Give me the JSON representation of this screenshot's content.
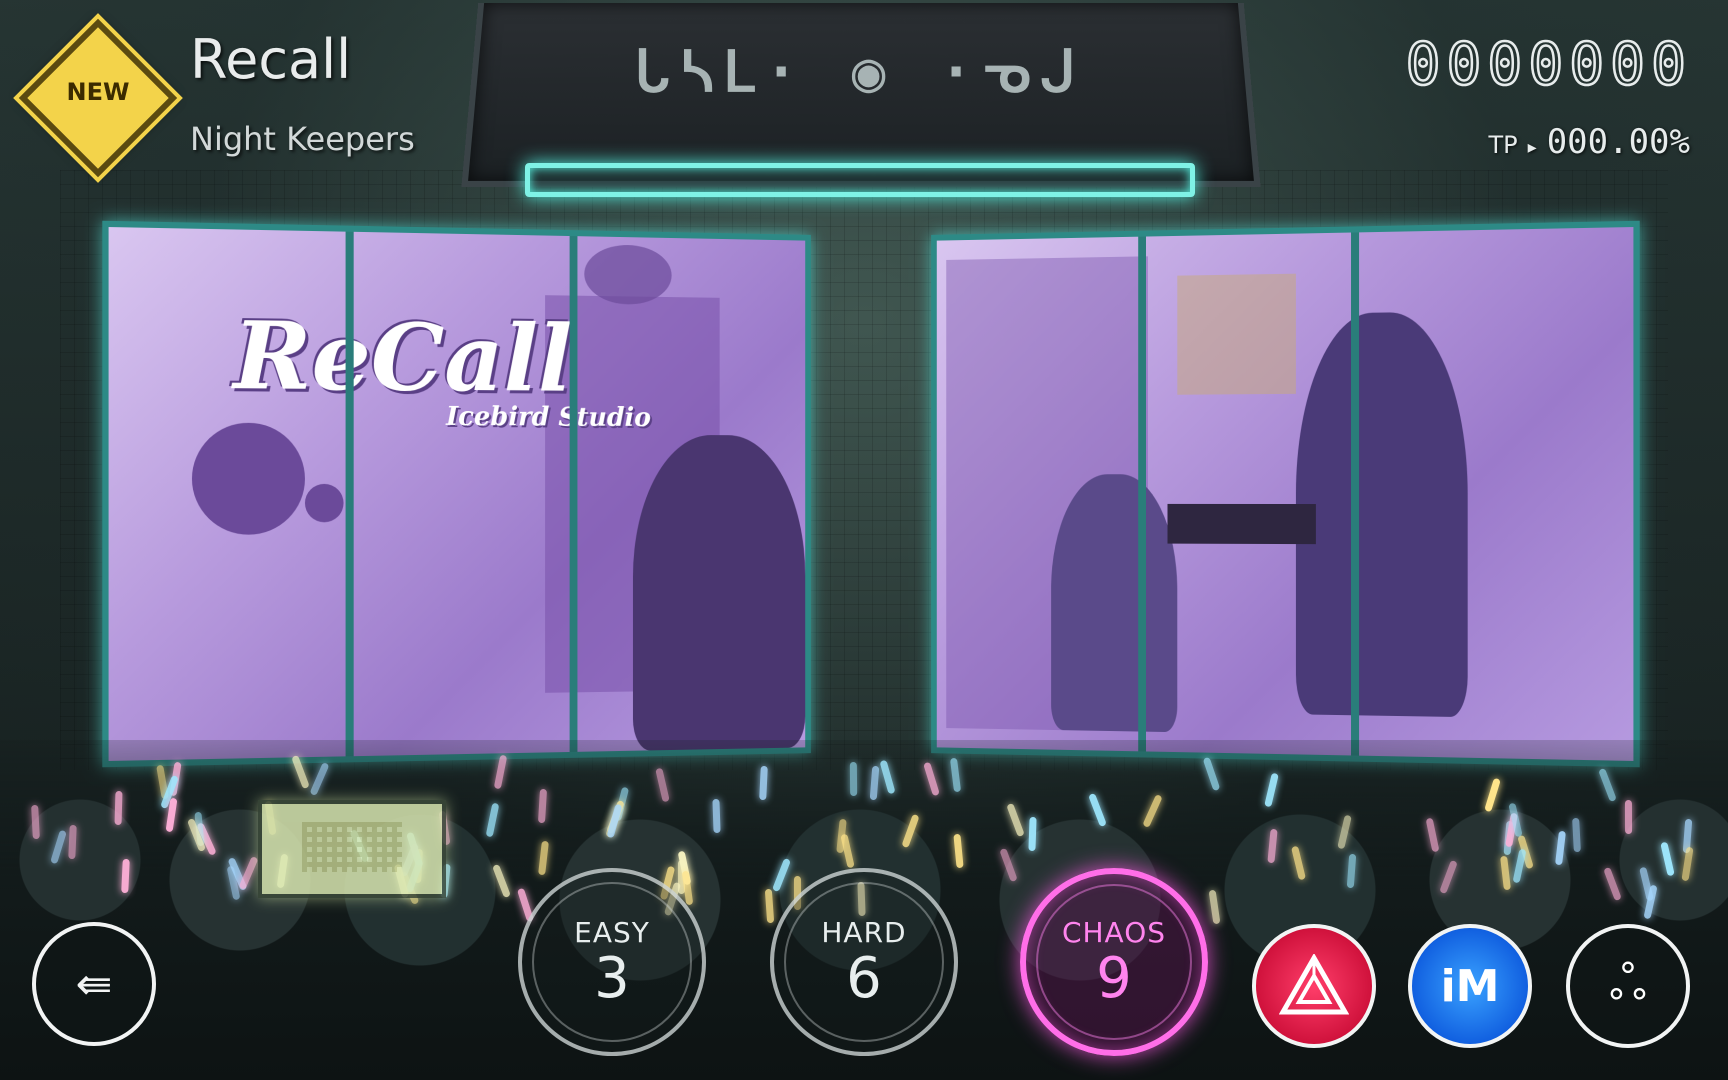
{
  "song": {
    "title": "Recall",
    "artist": "Night Keepers",
    "badge": "NEW"
  },
  "score": {
    "value": "0000000",
    "tp_label": "TP",
    "tp_value": "000.00%"
  },
  "marquee": {
    "glyphs": "ᒐᓴᒪ· ◉ ·ᓀᒍ"
  },
  "cover": {
    "logo": "ReCall",
    "studio": "Icebird Studio"
  },
  "difficulties": [
    {
      "name": "EASY",
      "level": "3"
    },
    {
      "name": "HARD",
      "level": "6"
    },
    {
      "name": "CHAOS",
      "level": "9"
    }
  ],
  "selected_difficulty": "CHAOS",
  "buttons": {
    "back_icon": "⇚",
    "mode2_label": "iM",
    "mode3_glyph": "ஃ"
  },
  "colors": {
    "accent_chaos": "#ff6ee8",
    "neon_teal": "#7ff2e6",
    "badge_yellow": "#f3d34a"
  },
  "icons": {
    "back": "back-arrow-icon",
    "mode1": "triangle-logo-icon",
    "mode2": "im-logo-icon",
    "mode3": "swirl-logo-icon"
  }
}
